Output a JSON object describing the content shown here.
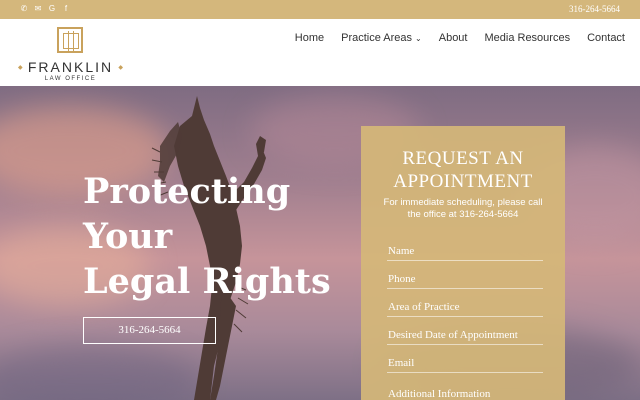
{
  "topbar": {
    "icons": [
      {
        "name": "phone-icon",
        "glyph": "✆"
      },
      {
        "name": "email-icon",
        "glyph": "✉"
      },
      {
        "name": "google-icon",
        "glyph": "G"
      },
      {
        "name": "facebook-icon",
        "glyph": "f"
      }
    ],
    "phone": "316-264-5664"
  },
  "logo": {
    "name": "FRANKLIN",
    "subtitle": "LAW OFFICE"
  },
  "nav": {
    "home": "Home",
    "practice_areas": "Practice Areas",
    "about": "About",
    "media_resources": "Media Resources",
    "contact": "Contact"
  },
  "hero": {
    "title_line1": "Protecting",
    "title_line2": "Your",
    "title_line3": "Legal Rights",
    "button": "316-264-5664"
  },
  "form": {
    "title_line1": "REQUEST AN",
    "title_line2": "APPOINTMENT",
    "subtitle": "For immediate scheduling, please call the office at 316-264-5664",
    "fields": {
      "name": "Name",
      "phone": "Phone",
      "area": "Area of Practice",
      "date": "Desired Date of Appointment",
      "email": "Email",
      "info": "Additional Information"
    }
  },
  "colors": {
    "accent": "#d4b77c",
    "form_bg": "#d5b778",
    "text_dark": "#333333"
  }
}
